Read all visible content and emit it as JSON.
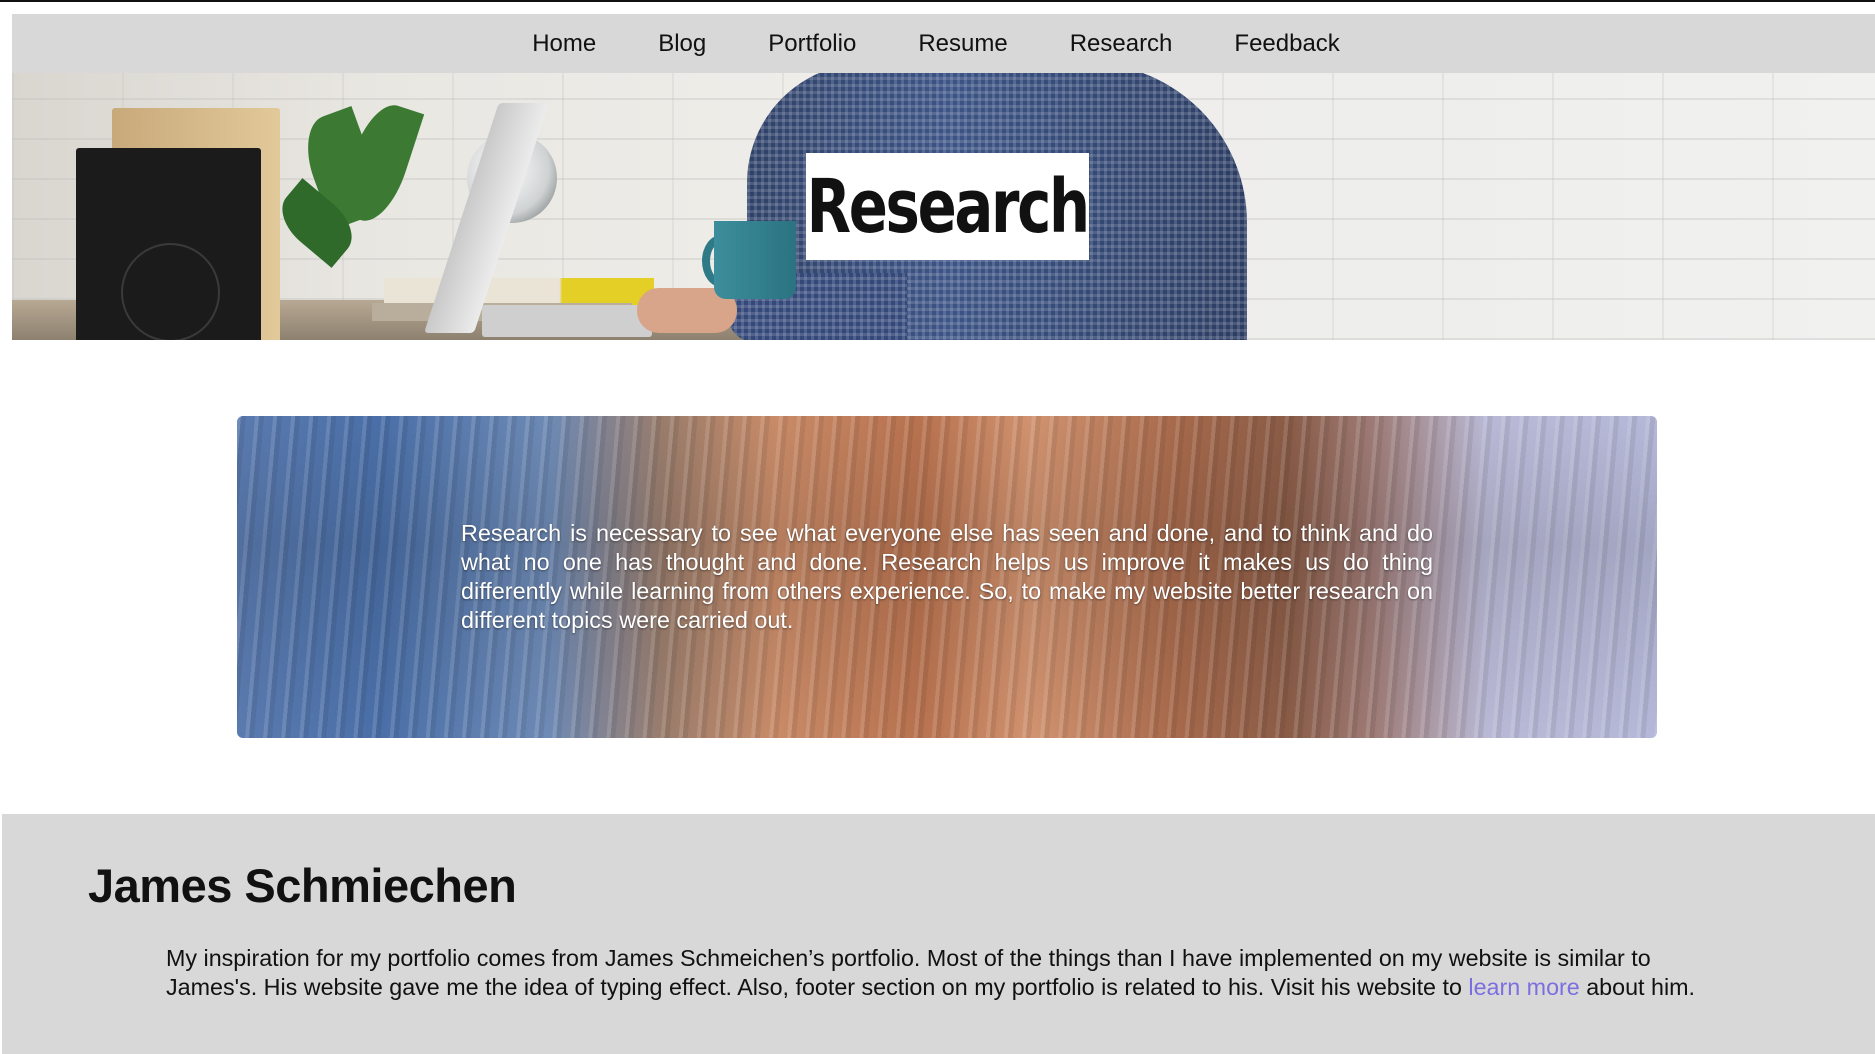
{
  "nav": {
    "items": [
      {
        "label": "Home"
      },
      {
        "label": "Blog"
      },
      {
        "label": "Portfolio"
      },
      {
        "label": "Resume"
      },
      {
        "label": "Research"
      },
      {
        "label": "Feedback"
      }
    ]
  },
  "hero": {
    "title": "Research"
  },
  "banner": {
    "text": "Research is necessary to see what everyone else has seen and done, and to think and do what no one has thought and done. Research helps us improve it makes us do thing differently while learning from others experience. So, to make my website better research on different topics were carried out."
  },
  "footer": {
    "name": "James Schmiechen",
    "text_before_link": "My inspiration for my portfolio comes from James Schmeichen’s portfolio. Most of the things than I have implemented on my website is similar to James's. His website gave me the idea of typing effect. Also, footer section on my portfolio is related to his. Visit his website to ",
    "link_label": "learn more",
    "text_after_link": " about him."
  },
  "colors": {
    "nav_background": "#d8d8d8",
    "footer_background": "#d8d8d8",
    "link": "#7b6fe0"
  }
}
